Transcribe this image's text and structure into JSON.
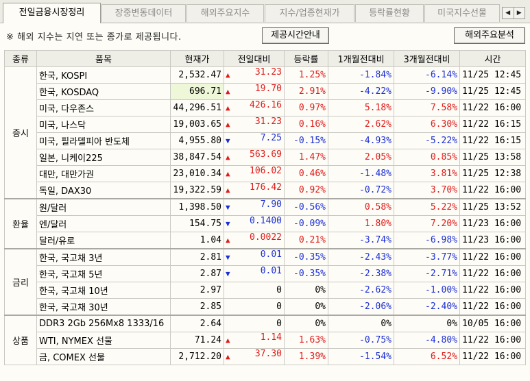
{
  "tabs": [
    {
      "label": "전일금융시장정리",
      "active": true
    },
    {
      "label": "장중변동데이터",
      "active": false
    },
    {
      "label": "해외주요지수",
      "active": false
    },
    {
      "label": "지수/업종현재가",
      "active": false
    },
    {
      "label": "등락률현황",
      "active": false
    },
    {
      "label": "미국지수선물",
      "active": false
    }
  ],
  "scroll": {
    "left": "◀",
    "right": "▶"
  },
  "notice": "※ 해외 지수는 지연 또는 종가로 제공됩니다.",
  "buttons": {
    "provide_time": "제공시간안내",
    "overseas_analysis": "해외주요분석"
  },
  "table": {
    "headers": [
      "종류",
      "품목",
      "현재가",
      "전일대비",
      "등락률",
      "1개월전대비",
      "3개월전대비",
      "시간"
    ],
    "groups": [
      {
        "category": "증시",
        "rows": [
          {
            "name": "한국, KOSPI",
            "price": "2,532.47",
            "dir": "up",
            "arrow": "▲",
            "change": "31.23",
            "rate": "1.25%",
            "m1": "-1.84%",
            "m1dir": "down",
            "m3": "-6.14%",
            "m3dir": "down",
            "time": "11/25 12:45"
          },
          {
            "name": "한국, KOSDAQ",
            "price": "696.71",
            "dir": "up",
            "arrow": "▲",
            "change": "19.70",
            "rate": "2.91%",
            "m1": "-4.22%",
            "m1dir": "down",
            "m3": "-9.90%",
            "m3dir": "down",
            "time": "11/25 12:45"
          },
          {
            "name": "미국, 다우존스",
            "price": "44,296.51",
            "dir": "up",
            "arrow": "▲",
            "change": "426.16",
            "rate": "0.97%",
            "m1": "5.18%",
            "m1dir": "up",
            "m3": "7.58%",
            "m3dir": "up",
            "time": "11/22 16:00"
          },
          {
            "name": "미국, 나스닥",
            "price": "19,003.65",
            "dir": "up",
            "arrow": "▲",
            "change": "31.23",
            "rate": "0.16%",
            "m1": "2.62%",
            "m1dir": "up",
            "m3": "6.30%",
            "m3dir": "up",
            "time": "11/22 16:15"
          },
          {
            "name": "미국, 필라델피아 반도체",
            "price": "4,955.80",
            "dir": "down",
            "arrow": "▼",
            "change": "7.25",
            "rate": "-0.15%",
            "m1": "-4.93%",
            "m1dir": "down",
            "m3": "-5.22%",
            "m3dir": "down",
            "time": "11/22 16:15"
          },
          {
            "name": "일본, 니케이225",
            "price": "38,847.54",
            "dir": "up",
            "arrow": "▲",
            "change": "563.69",
            "rate": "1.47%",
            "m1": "2.05%",
            "m1dir": "up",
            "m3": "0.85%",
            "m3dir": "up",
            "time": "11/25 13:58"
          },
          {
            "name": "대만, 대만가권",
            "price": "23,010.34",
            "dir": "up",
            "arrow": "▲",
            "change": "106.02",
            "rate": "0.46%",
            "m1": "-1.48%",
            "m1dir": "down",
            "m3": "3.81%",
            "m3dir": "up",
            "time": "11/25 12:38"
          },
          {
            "name": "독일, DAX30",
            "price": "19,322.59",
            "dir": "up",
            "arrow": "▲",
            "change": "176.42",
            "rate": "0.92%",
            "m1": "-0.72%",
            "m1dir": "down",
            "m3": "3.70%",
            "m3dir": "up",
            "time": "11/22 16:00"
          }
        ]
      },
      {
        "category": "환율",
        "rows": [
          {
            "name": "원/달러",
            "price": "1,398.50",
            "dir": "down",
            "arrow": "▼",
            "change": "7.90",
            "rate": "-0.56%",
            "m1": "0.58%",
            "m1dir": "up",
            "m3": "5.22%",
            "m3dir": "up",
            "time": "11/25 13:52"
          },
          {
            "name": "엔/달러",
            "price": "154.75",
            "dir": "down",
            "arrow": "▼",
            "change": "0.1400",
            "rate": "-0.09%",
            "m1": "1.80%",
            "m1dir": "up",
            "m3": "7.20%",
            "m3dir": "up",
            "time": "11/23 16:00"
          },
          {
            "name": "달러/유로",
            "price": "1.04",
            "dir": "up",
            "arrow": "▲",
            "change": "0.0022",
            "rate": "0.21%",
            "m1": "-3.74%",
            "m1dir": "down",
            "m3": "-6.98%",
            "m3dir": "down",
            "time": "11/23 16:00"
          }
        ]
      },
      {
        "category": "금리",
        "rows": [
          {
            "name": "한국, 국고채 3년",
            "price": "2.81",
            "dir": "down",
            "arrow": "▼",
            "change": "0.01",
            "rate": "-0.35%",
            "m1": "-2.43%",
            "m1dir": "down",
            "m3": "-3.77%",
            "m3dir": "down",
            "time": "11/22 16:00"
          },
          {
            "name": "한국, 국고채 5년",
            "price": "2.87",
            "dir": "down",
            "arrow": "▼",
            "change": "0.01",
            "rate": "-0.35%",
            "m1": "-2.38%",
            "m1dir": "down",
            "m3": "-2.71%",
            "m3dir": "down",
            "time": "11/22 16:00"
          },
          {
            "name": "한국, 국고채 10년",
            "price": "2.97",
            "dir": "zero",
            "arrow": "",
            "change": "0",
            "rate": "0%",
            "m1": "-2.62%",
            "m1dir": "down",
            "m3": "-1.00%",
            "m3dir": "down",
            "time": "11/22 16:00"
          },
          {
            "name": "한국, 국고채 30년",
            "price": "2.85",
            "dir": "zero",
            "arrow": "",
            "change": "0",
            "rate": "0%",
            "m1": "-2.06%",
            "m1dir": "down",
            "m3": "-2.40%",
            "m3dir": "down",
            "time": "11/22 16:00"
          }
        ]
      },
      {
        "category": "상품",
        "rows": [
          {
            "name": "DDR3 2Gb 256Mx8 1333/16",
            "price": "2.64",
            "dir": "zero",
            "arrow": "",
            "change": "0",
            "rate": "0%",
            "m1": "0%",
            "m1dir": "zero",
            "m3": "0%",
            "m3dir": "zero",
            "time": "10/05 16:00"
          },
          {
            "name": "WTI, NYMEX 선물",
            "price": "71.24",
            "dir": "up",
            "arrow": "▲",
            "change": "1.14",
            "rate": "1.63%",
            "m1": "-0.75%",
            "m1dir": "down",
            "m3": "-4.80%",
            "m3dir": "down",
            "time": "11/22 16:00"
          },
          {
            "name": "금, COMEX 선물",
            "price": "2,712.20",
            "dir": "up",
            "arrow": "▲",
            "change": "37.30",
            "rate": "1.39%",
            "m1": "-1.54%",
            "m1dir": "down",
            "m3": "6.52%",
            "m3dir": "up",
            "time": "11/22 16:00"
          }
        ]
      }
    ]
  },
  "highlight_row": "한국, KOSDAQ",
  "colors": {
    "up": "#e01a1a",
    "down": "#1c2fd6",
    "highlight": "#eef7d8"
  }
}
